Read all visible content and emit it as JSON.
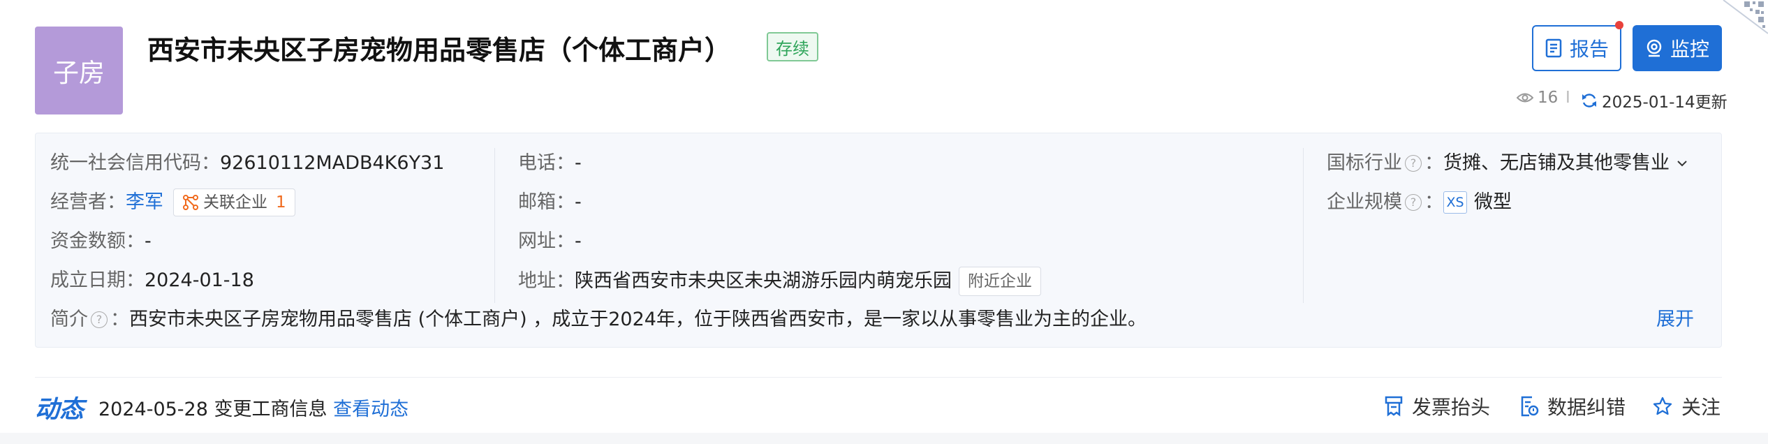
{
  "company": {
    "logo_text": "子房",
    "name": "西安市未央区子房宠物用品零售店（个体工商户）",
    "status": "存续"
  },
  "buttons": {
    "report": "报告",
    "monitor": "监控"
  },
  "meta": {
    "views": "16",
    "sep": "I",
    "updated": "2025-01-14更新"
  },
  "info": {
    "credit_label": "统一社会信用代码：",
    "credit_value": "92610112MADB4K6Y31",
    "operator_label": "经营者：",
    "operator_value": "李军",
    "related_label": "关联企业",
    "related_count": "1",
    "capital_label": "资金数额：",
    "capital_value": "-",
    "founded_label": "成立日期：",
    "founded_value": "2024-01-18",
    "phone_label": "电话：",
    "phone_value": "-",
    "email_label": "邮箱：",
    "email_value": "-",
    "website_label": "网址：",
    "website_value": "-",
    "address_label": "地址：",
    "address_value": "陕西省西安市未央区未央湖游乐园内萌宠乐园",
    "nearby_label": "附近企业",
    "industry_label": "国标行业",
    "industry_value": "货摊、无店铺及其他零售业",
    "scale_label": "企业规模",
    "scale_tag": "XS",
    "scale_value": "微型",
    "intro_label": "简介",
    "intro_value": "西安市未央区子房宠物用品零售店 (个体工商户) ，成立于2024年，位于陕西省西安市，是一家以从事零售业为主的企业。",
    "expand": "展开",
    "help_glyph": "?",
    "colon": "："
  },
  "dynamics": {
    "title": "动态",
    "text": "2024-05-28 变更工商信息",
    "link": "查看动态"
  },
  "actions": {
    "invoice": "发票抬头",
    "correction": "数据纠错",
    "follow": "关注"
  },
  "colors": {
    "accent": "#1f6fd6",
    "logo_bg": "#b49ad9",
    "status_green": "#2fa55a",
    "count_orange": "#f06a1d"
  }
}
